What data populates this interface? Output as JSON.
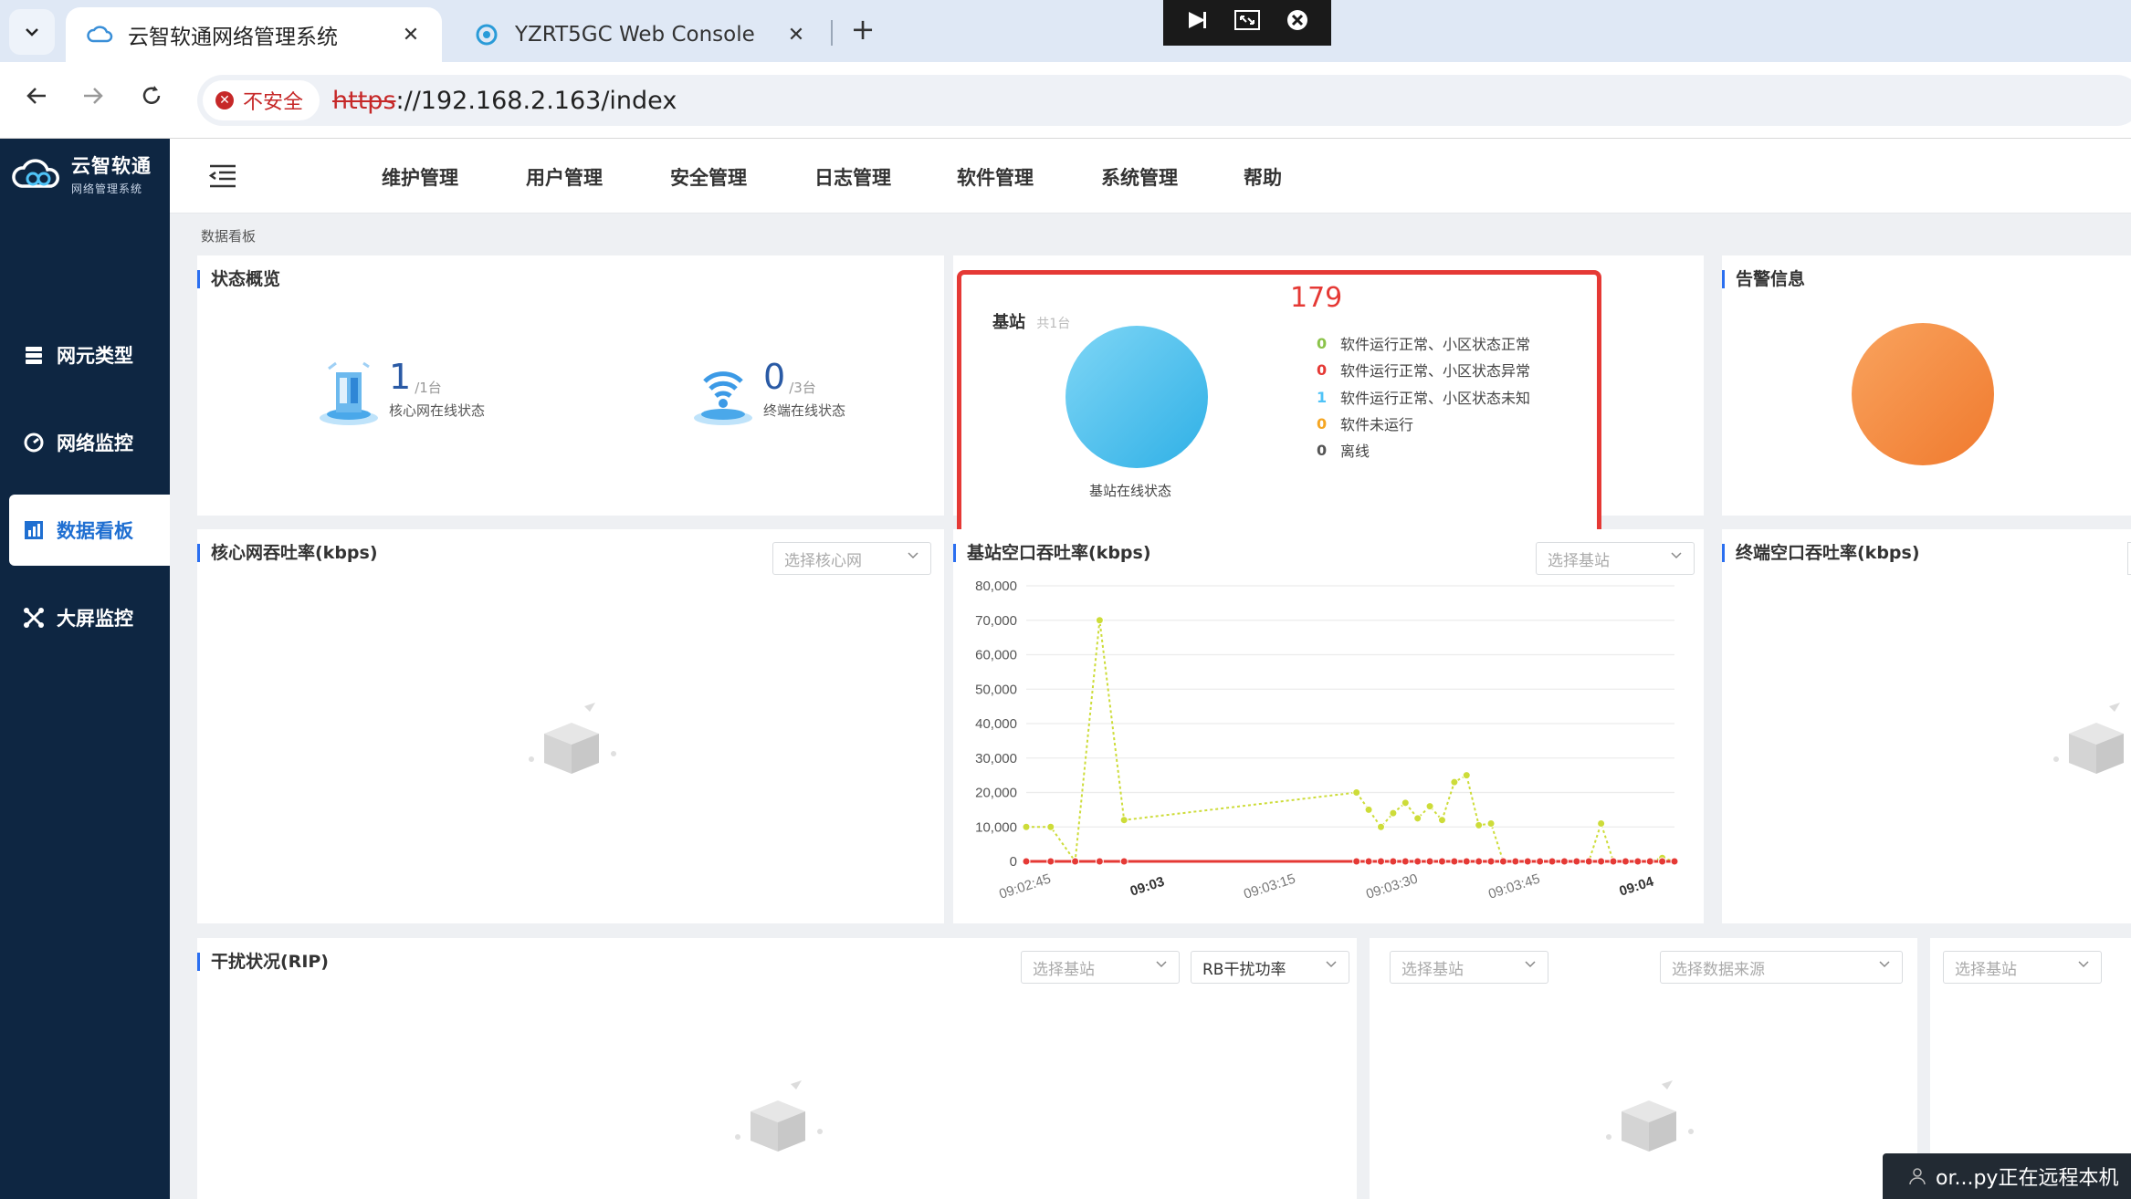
{
  "browser": {
    "tabs": [
      {
        "title": "云智软通网络管理系统",
        "active": true
      },
      {
        "title": "YZRT5GC Web Console",
        "active": false
      }
    ],
    "address": {
      "security_label": "不安全",
      "url_scheme": "https",
      "url_rest": "://192.168.2.163/index"
    }
  },
  "sidebar": {
    "logo_name": "云智软通",
    "logo_sub": "网络管理系统",
    "items": [
      {
        "label": "网元类型",
        "icon": "server-icon"
      },
      {
        "label": "网络监控",
        "icon": "monitor-gauge-icon"
      },
      {
        "label": "数据看板",
        "icon": "bar-chart-icon",
        "active": true
      },
      {
        "label": "大屏监控",
        "icon": "cross-arrows-icon"
      }
    ]
  },
  "topnav": {
    "items": [
      "维护管理",
      "用户管理",
      "安全管理",
      "日志管理",
      "软件管理",
      "系统管理",
      "帮助"
    ]
  },
  "breadcrumb": "数据看板",
  "status_overview": {
    "title": "状态概览",
    "core": {
      "count": "1",
      "total": "/1台",
      "label": "核心网在线状态"
    },
    "terminal": {
      "count": "0",
      "total": "/3台",
      "label": "终端在线状态"
    }
  },
  "base_station": {
    "title": "基站",
    "subtitle": "共1台",
    "annotation": "179",
    "pie_label": "基站在线状态",
    "legend": [
      {
        "count": "0",
        "text": "软件运行正常、小区状态正常",
        "color": "#8bc34a"
      },
      {
        "count": "0",
        "text": "软件运行正常、小区状态异常",
        "color": "#e53935"
      },
      {
        "count": "1",
        "text": "软件运行正常、小区状态未知",
        "color": "#4fc3f7"
      },
      {
        "count": "0",
        "text": "软件未运行",
        "color": "#f5a623"
      },
      {
        "count": "0",
        "text": "离线",
        "color": "#555555"
      }
    ]
  },
  "alarm": {
    "title": "告警信息"
  },
  "core_throughput": {
    "title": "核心网吞吐率(kbps)",
    "select_placeholder": "选择核心网"
  },
  "bs_throughput": {
    "title": "基站空口吞吐率(kbps)",
    "select_placeholder": "选择基站"
  },
  "ue_throughput": {
    "title": "终端空口吞吐率(kbps)"
  },
  "interference": {
    "title": "干扰状况(RIP)",
    "select_bs": "选择基站",
    "select_metric": "RB干扰功率",
    "select_bs2": "选择基站",
    "select_source": "选择数据来源",
    "select_bs3": "选择基站"
  },
  "remote_toast": "or...py正在远程本机",
  "colors": {
    "sidebar_bg": "#0e2642",
    "accent": "#2b6ff0",
    "highlight_border": "#e53935",
    "series_green": "#cddc39",
    "series_red": "#e53935",
    "pie_blue": "#4fc3f7",
    "pie_orange": "#f58a3c"
  },
  "chart_data": {
    "type": "line",
    "title": "基站空口吞吐率(kbps)",
    "ylim": [
      0,
      80000
    ],
    "y_ticks": [
      "80,000",
      "70,000",
      "60,000",
      "50,000",
      "40,000",
      "30,000",
      "20,000",
      "10,000",
      "0"
    ],
    "x_ticks": [
      "09:02:45",
      "09:03",
      "09:03:15",
      "09:03:30",
      "09:03:45",
      "09:04"
    ],
    "x_tick_bold": [
      false,
      true,
      false,
      false,
      false,
      true
    ],
    "grid": true,
    "series": [
      {
        "color": "#cddc39",
        "points": [
          [
            0,
            10000
          ],
          [
            2,
            10000
          ],
          [
            4,
            0
          ],
          [
            6,
            70000
          ],
          [
            8,
            12000
          ],
          [
            27,
            20000
          ],
          [
            28,
            15000
          ],
          [
            29,
            10000
          ],
          [
            30,
            14000
          ],
          [
            31,
            17000
          ],
          [
            32,
            12500
          ],
          [
            33,
            16000
          ],
          [
            34,
            12000
          ],
          [
            35,
            23000
          ],
          [
            36,
            25000
          ],
          [
            37,
            10500
          ],
          [
            38,
            11000
          ],
          [
            39,
            0
          ],
          [
            40,
            0
          ],
          [
            41,
            0
          ],
          [
            42,
            0
          ],
          [
            43,
            0
          ],
          [
            44,
            0
          ],
          [
            45,
            0
          ],
          [
            46,
            0
          ],
          [
            47,
            11000
          ],
          [
            48,
            0
          ],
          [
            49,
            0
          ],
          [
            50,
            0
          ],
          [
            51,
            0
          ],
          [
            52,
            1000
          ],
          [
            53,
            0
          ]
        ]
      },
      {
        "color": "#e53935",
        "points": [
          [
            0,
            0
          ],
          [
            2,
            0
          ],
          [
            4,
            0
          ],
          [
            6,
            0
          ],
          [
            8,
            0
          ],
          [
            27,
            0
          ],
          [
            28,
            0
          ],
          [
            29,
            0
          ],
          [
            30,
            0
          ],
          [
            31,
            0
          ],
          [
            32,
            0
          ],
          [
            33,
            0
          ],
          [
            34,
            0
          ],
          [
            35,
            0
          ],
          [
            36,
            0
          ],
          [
            37,
            0
          ],
          [
            38,
            0
          ],
          [
            39,
            0
          ],
          [
            40,
            0
          ],
          [
            41,
            0
          ],
          [
            42,
            0
          ],
          [
            43,
            0
          ],
          [
            44,
            0
          ],
          [
            45,
            0
          ],
          [
            46,
            0
          ],
          [
            47,
            0
          ],
          [
            48,
            0
          ],
          [
            49,
            0
          ],
          [
            50,
            0
          ],
          [
            51,
            0
          ],
          [
            52,
            0
          ],
          [
            53,
            0
          ]
        ]
      }
    ]
  }
}
